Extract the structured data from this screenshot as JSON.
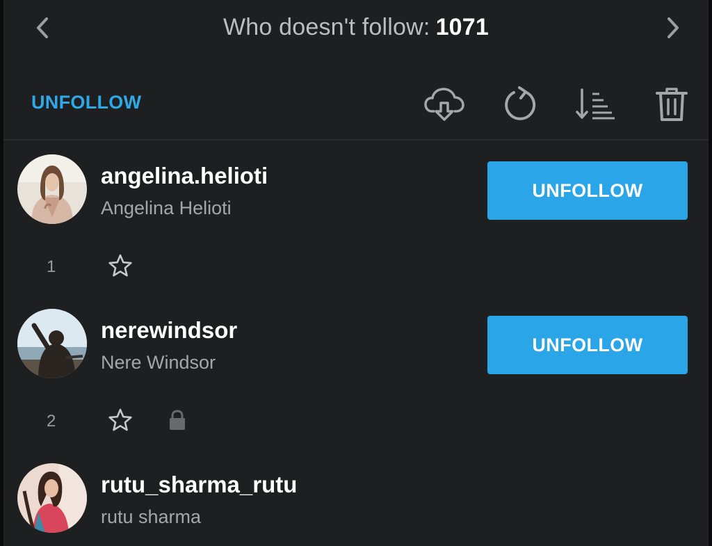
{
  "header": {
    "title": "Who doesn't follow:",
    "count": "1071",
    "prev_icon": "chevron-left-icon",
    "next_icon": "chevron-right-icon"
  },
  "toolbar": {
    "tab_label": "UNFOLLOW",
    "icons": [
      "cloud-download-icon",
      "refresh-icon",
      "sort-icon",
      "trash-icon"
    ]
  },
  "colors": {
    "accent": "#2aa5e8",
    "background": "#1e1f20",
    "text_secondary": "#a6a6a6"
  },
  "users": [
    {
      "username": "angelina.helioti",
      "full_name": "Angelina Helioti",
      "index": "1",
      "button": "UNFOLLOW",
      "starred": false,
      "private": false
    },
    {
      "username": "nerewindsor",
      "full_name": "Nere Windsor",
      "index": "2",
      "button": "UNFOLLOW",
      "starred": false,
      "private": true
    },
    {
      "username": "rutu_sharma_rutu",
      "full_name": "rutu sharma"
    }
  ]
}
